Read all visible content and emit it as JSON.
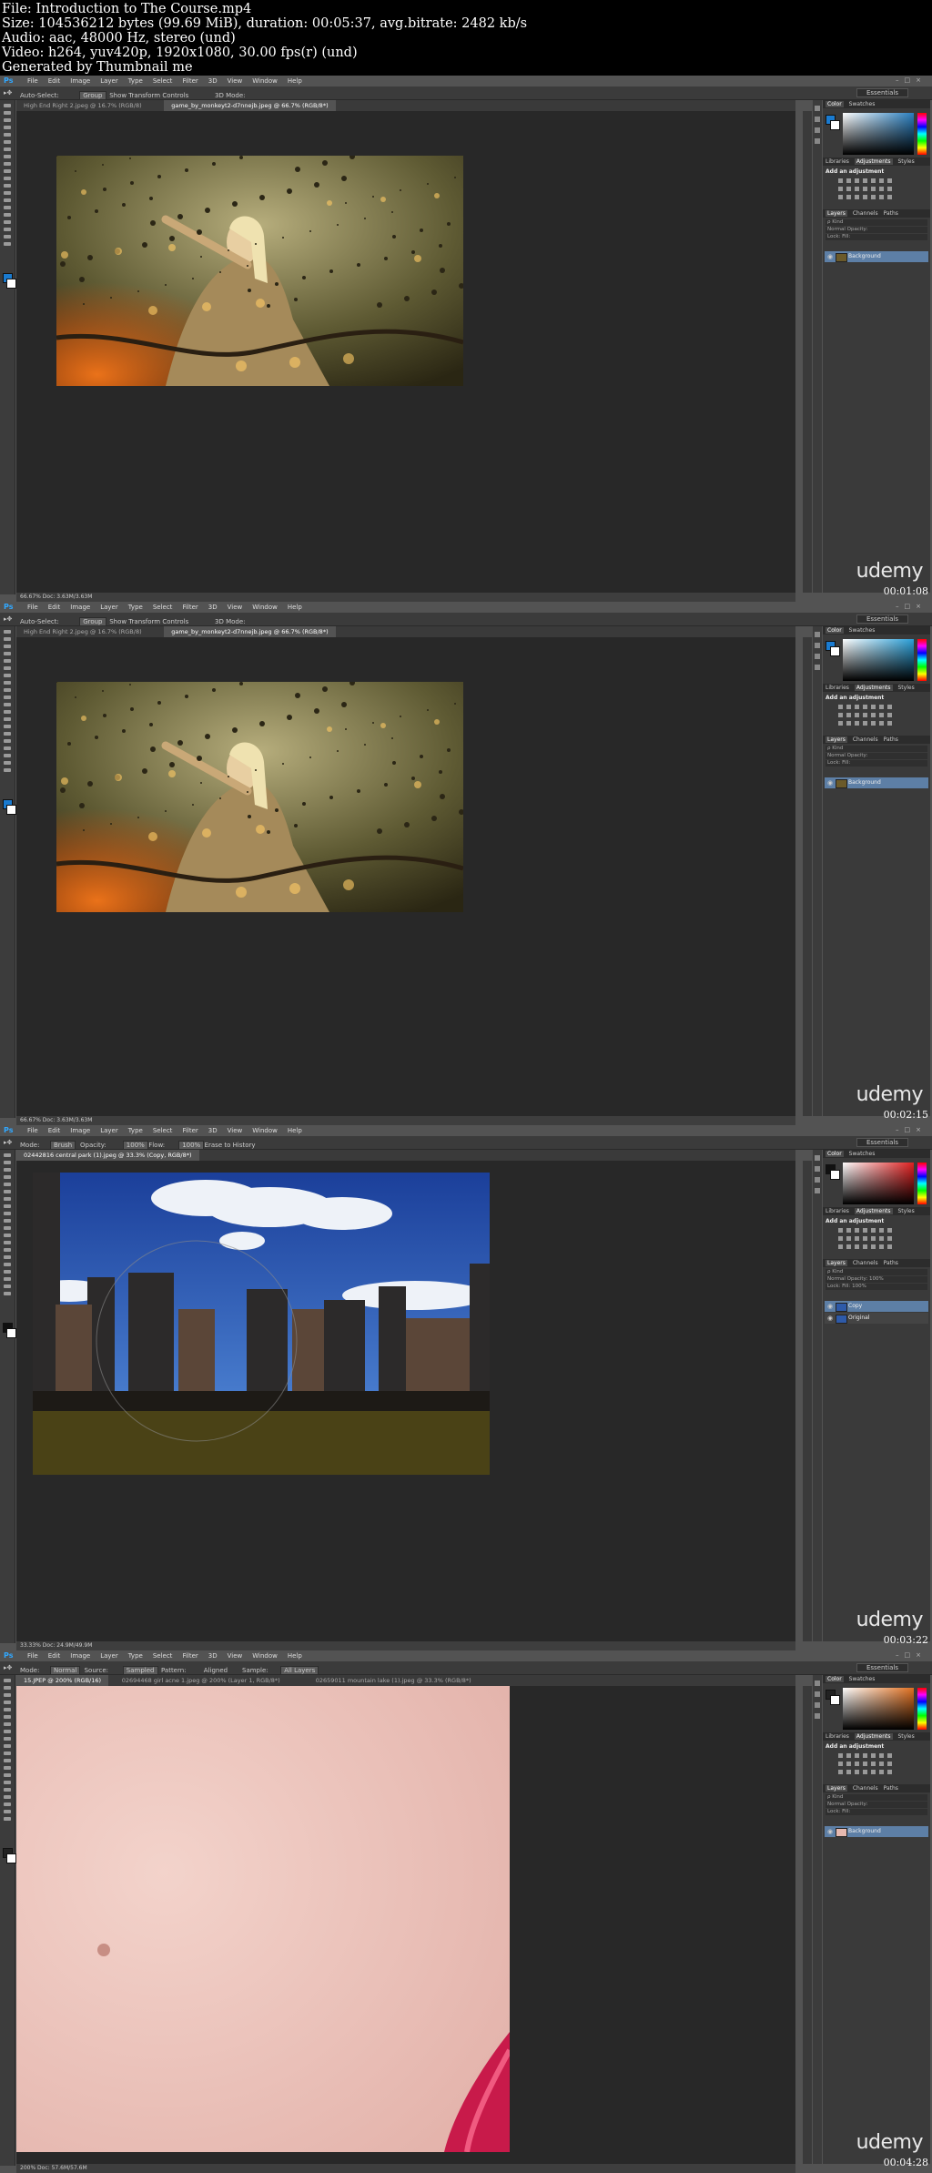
{
  "header": {
    "lines": [
      "File: Introduction to The Course.mp4",
      "Size: 104536212 bytes (99.69 MiB), duration: 00:05:37, avg.bitrate: 2482 kb/s",
      "Audio: aac, 48000 Hz, stereo (und)",
      "Video: h264, yuv420p, 1920x1080, 30.00 fps(r) (und)",
      "Generated by Thumbnail me"
    ]
  },
  "app": {
    "logo": "Ps",
    "menu": [
      "File",
      "Edit",
      "Image",
      "Layer",
      "Type",
      "Select",
      "Filter",
      "3D",
      "View",
      "Window",
      "Help"
    ],
    "workspace": "Essentials",
    "watermark": "udemy"
  },
  "frames": [
    {
      "options": [
        "Auto-Select:",
        "Group",
        "Show Transform Controls",
        "3D Mode:"
      ],
      "tabs": [
        "High End Right 2.jpeg @ 16.7% (RGB/8)",
        "game_by_monkeyt2-d7nnejb.jpeg @ 66.7% (RGB/8*)"
      ],
      "active_tab": 1,
      "status": "66.67%   Doc: 3.63M/3.63M",
      "color_tabs": [
        "Color",
        "Swatches"
      ],
      "adj_tabs": [
        "Libraries",
        "Adjustments",
        "Styles"
      ],
      "adj_title": "Add an adjustment",
      "layer_tabs": [
        "Layers",
        "Channels",
        "Paths"
      ],
      "layer_ctrls": [
        "ρ Kind",
        "Normal          Opacity:",
        "Lock:                Fill:"
      ],
      "layers": [
        {
          "name": "Background",
          "selected": true
        }
      ],
      "timecode": "00:01:08",
      "fg_color": "#1a7bd0",
      "field_hue": "#2a7fbf"
    },
    {
      "options": [
        "Auto-Select:",
        "Group",
        "Show Transform Controls",
        "3D Mode:"
      ],
      "tabs": [
        "High End Right 2.jpeg @ 16.7% (RGB/8)",
        "game_by_monkeyt2-d7nnejb.jpeg @ 66.7% (RGB/8*)"
      ],
      "active_tab": 1,
      "status": "66.67%   Doc: 3.63M/3.63M",
      "color_tabs": [
        "Color",
        "Swatches"
      ],
      "adj_tabs": [
        "Libraries",
        "Adjustments",
        "Styles"
      ],
      "adj_title": "Add an adjustment",
      "layer_tabs": [
        "Layers",
        "Channels",
        "Paths"
      ],
      "layer_ctrls": [
        "ρ Kind",
        "Normal          Opacity:",
        "Lock:                Fill:"
      ],
      "layers": [
        {
          "name": "Background",
          "selected": true
        }
      ],
      "timecode": "00:02:15",
      "fg_color": "#1a7bd0",
      "field_hue": "#2a9fd8"
    },
    {
      "options": [
        "Mode:",
        "Brush",
        "Opacity:",
        "100%",
        "Flow:",
        "100%",
        "Erase to History"
      ],
      "tabs": [
        "02442816 central park (1).jpeg @ 33.3% (Copy, RGB/8*)"
      ],
      "active_tab": 0,
      "status": "33.33%   Doc: 24.9M/49.9M",
      "color_tabs": [
        "Color",
        "Swatches"
      ],
      "adj_tabs": [
        "Libraries",
        "Adjustments",
        "Styles"
      ],
      "adj_title": "Add an adjustment",
      "layer_tabs": [
        "Layers",
        "Channels",
        "Paths"
      ],
      "layer_ctrls": [
        "ρ Kind",
        "Normal          Opacity: 100%",
        "Lock:                Fill: 100%"
      ],
      "layers": [
        {
          "name": "Copy",
          "selected": true
        },
        {
          "name": "Original",
          "selected": false
        }
      ],
      "timecode": "00:03:22",
      "fg_color": "#111111",
      "field_hue": "#e02020"
    },
    {
      "options": [
        "Mode:",
        "Normal",
        "Source:",
        "Sampled",
        "Pattern:",
        "Aligned",
        "Sample:",
        "All Layers"
      ],
      "tabs": [
        "15.JPEP @ 200% (RGB/16)",
        "02694468 girl acne 1.jpeg @ 200% (Layer 1, RGB/8*)",
        "02659011 mountain lake (1).jpeg @ 33.3% (RGB/8*)"
      ],
      "active_tab": 0,
      "status": "200%   Doc: 57.6M/57.6M",
      "color_tabs": [
        "Color",
        "Swatches"
      ],
      "adj_tabs": [
        "Libraries",
        "Adjustments",
        "Styles"
      ],
      "adj_title": "Add an adjustment",
      "layer_tabs": [
        "Layers",
        "Channels",
        "Paths"
      ],
      "layer_ctrls": [
        "ρ Kind",
        "Normal          Opacity:",
        "Lock:                Fill:"
      ],
      "layers": [
        {
          "name": "Background",
          "selected": true
        }
      ],
      "timecode": "00:04:28",
      "fg_color": "#222222",
      "field_hue": "#e07020"
    }
  ]
}
